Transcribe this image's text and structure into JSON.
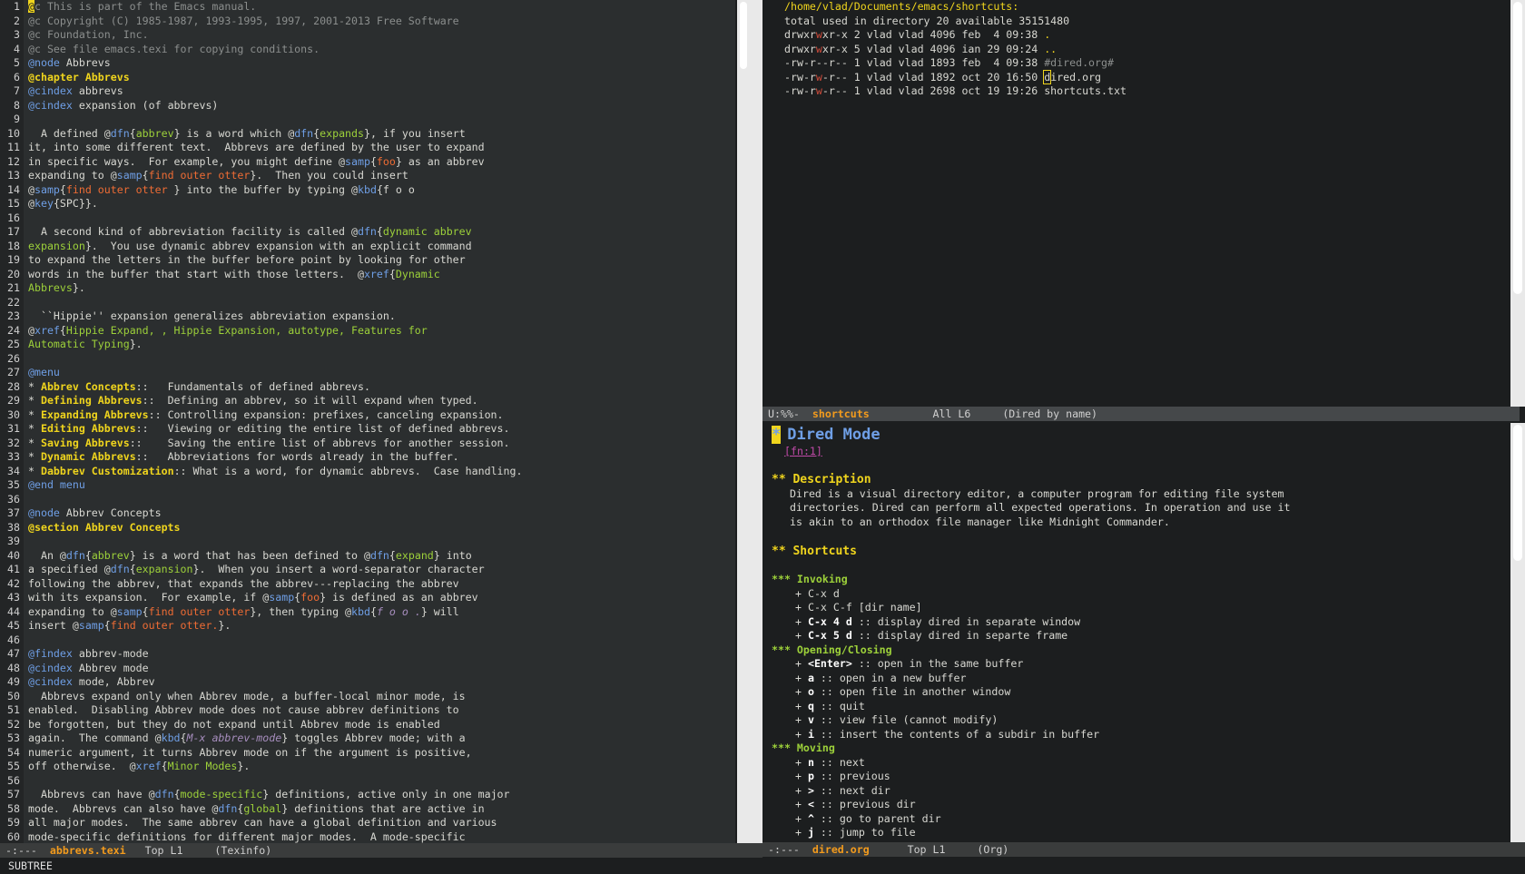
{
  "left": {
    "lines": [
      "<span class=\"cursor\">@</span><span class=\"cm\">c This is part of the Emacs manual.</span>",
      "<span class=\"cm\">@c Copyright (C) 1985-1987, 1993-1995, 1997, 2001-2013 Free Software</span>",
      "<span class=\"cm\">@c Foundation, Inc.</span>",
      "<span class=\"cm\">@c See file emacs.texi for copying conditions.</span>",
      "<span class=\"kn\">@node</span> Abbrevs",
      "<span class=\"h\">@chapter Abbrevs</span>",
      "<span class=\"kn\">@cindex</span> abbrevs",
      "<span class=\"kn\">@cindex</span> expansion (of abbrevs)",
      "",
      "  A defined @<span class=\"kn\">dfn</span>{<span class=\"g\">abbrev</span>} is a word which @<span class=\"kn\">dfn</span>{<span class=\"g\">expands</span>}, if you insert",
      "it, into some different text.  Abbrevs are defined by the user to expand",
      "in specific ways.  For example, you might define @<span class=\"kn\">samp</span>{<span class=\"o\">foo</span>} as an abbrev",
      "expanding to @<span class=\"kn\">samp</span>{<span class=\"o\">find outer otter</span>}.  Then you could insert",
      "@<span class=\"kn\">samp</span>{<span class=\"o\">find outer otter</span> } into the buffer by typing @<span class=\"kn\">kbd</span>{f o o",
      "@<span class=\"kn\">key</span>{SPC}}.",
      "",
      "  A second kind of abbreviation facility is called @<span class=\"kn\">dfn</span>{<span class=\"g\">dynamic abbrev</span>",
      "<span class=\"g\">expansion</span>}.  You use dynamic abbrev expansion with an explicit command",
      "to expand the letters in the buffer before point by looking for other",
      "words in the buffer that start with those letters.  @<span class=\"kn\">xref</span>{<span class=\"g\">Dynamic</span>",
      "<span class=\"g\">Abbrevs</span>}.",
      "",
      "  ``Hippie'' expansion generalizes abbreviation expansion.",
      "@<span class=\"kn\">xref</span>{<span class=\"g\">Hippie Expand, , Hippie Expansion, autotype, Features for</span>",
      "<span class=\"g\">Automatic Typing</span>}.",
      "",
      "<span class=\"kn\">@menu</span>",
      "* <span class=\"h\">Abbrev Concepts</span>::   Fundamentals of defined abbrevs.",
      "* <span class=\"h\">Defining Abbrevs</span>::  Defining an abbrev, so it will expand when typed.",
      "* <span class=\"h\">Expanding Abbrevs</span>:: Controlling expansion: prefixes, canceling expansion.",
      "* <span class=\"h\">Editing Abbrevs</span>::   Viewing or editing the entire list of defined abbrevs.",
      "* <span class=\"h\">Saving Abbrevs</span>::    Saving the entire list of abbrevs for another session.",
      "* <span class=\"h\">Dynamic Abbrevs</span>::   Abbreviations for words already in the buffer.",
      "* <span class=\"h\">Dabbrev Customization</span>:: What is a word, for dynamic abbrevs.  Case handling.",
      "<span class=\"kn\">@end menu</span>",
      "",
      "<span class=\"kn\">@node</span> Abbrev Concepts",
      "<span class=\"h\">@section Abbrev Concepts</span>",
      "",
      "  An @<span class=\"kn\">dfn</span>{<span class=\"g\">abbrev</span>} is a word that has been defined to @<span class=\"kn\">dfn</span>{<span class=\"g\">expand</span>} into",
      "a specified @<span class=\"kn\">dfn</span>{<span class=\"g\">expansion</span>}.  When you insert a word-separator character",
      "following the abbrev, that expands the abbrev---replacing the abbrev",
      "with its expansion.  For example, if @<span class=\"kn\">samp</span>{<span class=\"o\">foo</span>} is defined as an abbrev",
      "expanding to @<span class=\"kn\">samp</span>{<span class=\"o\">find outer otter</span>}, then typing @<span class=\"kn\">kbd</span>{<span class=\"it\">f o o .</span>} will",
      "insert @<span class=\"kn\">samp</span>{<span class=\"o\">find outer otter.</span>}.",
      "",
      "<span class=\"kn\">@findex</span> abbrev-mode",
      "<span class=\"kn\">@cindex</span> Abbrev mode",
      "<span class=\"kn\">@cindex</span> mode, Abbrev",
      "  Abbrevs expand only when Abbrev mode, a buffer-local minor mode, is",
      "enabled.  Disabling Abbrev mode does not cause abbrev definitions to",
      "be forgotten, but they do not expand until Abbrev mode is enabled",
      "again.  The command @<span class=\"kn\">kbd</span>{<span class=\"it\">M-x abbrev-mode</span>} toggles Abbrev mode; with a",
      "numeric argument, it turns Abbrev mode on if the argument is positive,",
      "off otherwise.  @<span class=\"kn\">xref</span>{<span class=\"g\">Minor Modes</span>}.",
      "",
      "  Abbrevs can have @<span class=\"kn\">dfn</span>{<span class=\"g\">mode-specific</span>} definitions, active only in one major",
      "mode.  Abbrevs can also have @<span class=\"kn\">dfn</span>{<span class=\"g\">global</span>} definitions that are active in",
      "all major modes.  The same abbrev can have a global definition and various",
      "mode-specific definitions for different major modes.  A mode-specific"
    ],
    "modeline": {
      "status": "-:---",
      "buffer": "abbrevs.texi",
      "position": "Top L1",
      "mode": "(Texinfo)"
    }
  },
  "dired": {
    "path": "/home/vlad/Documents/emacs/shortcuts",
    "total": "total used in directory 20 available 35151480",
    "entries": [
      {
        "perm": "drwxrwxr-x",
        "links": "2",
        "user": "vlad",
        "group": "vlad",
        "size": "4096",
        "date": "feb  4 09:38",
        "name": "."
      },
      {
        "perm": "drwxrwxr-x",
        "links": "5",
        "user": "vlad",
        "group": "vlad",
        "size": "4096",
        "date": "ian 29 09:24",
        "name": ".."
      },
      {
        "perm": "-rw-r--r--",
        "links": "1",
        "user": "vlad",
        "group": "vlad",
        "size": "1893",
        "date": "feb  4 09:38",
        "name": "#dired.org#"
      },
      {
        "perm": "-rw-rw-r--",
        "links": "1",
        "user": "vlad",
        "group": "vlad",
        "size": "1892",
        "date": "oct 20 16:50",
        "name": "dired.org"
      },
      {
        "perm": "-rw-rw-r--",
        "links": "1",
        "user": "vlad",
        "group": "vlad",
        "size": "2698",
        "date": "oct 19 19:26",
        "name": "shortcuts.txt"
      }
    ],
    "modeline": {
      "status": "U:%%-",
      "buffer": "shortcuts",
      "position": "All L6",
      "mode": "(Dired by name)"
    }
  },
  "org": {
    "title_star": "*",
    "title": "Dired Mode",
    "footnote": "[fn:1]",
    "h_description": "** Description",
    "description": [
      "Dired is a visual directory editor, a computer program for editing file system",
      "directories. Dired can perform all expected operations. In operation and use it",
      "is akin to an orthodox file manager like Midnight Commander."
    ],
    "h_shortcuts": "** Shortcuts",
    "groups": [
      {
        "heading": "*** Invoking",
        "items": [
          {
            "key": "C-x d",
            "desc": "",
            "bold": false
          },
          {
            "key": "C-x C-f [dir name]",
            "desc": "",
            "bold": false
          },
          {
            "key": "C-x 4 d",
            "desc": ":: display dired in separate window",
            "bold": true
          },
          {
            "key": "C-x 5 d",
            "desc": ":: display dired in separte frame",
            "bold": true
          }
        ]
      },
      {
        "heading": "*** Opening/Closing",
        "items": [
          {
            "key": "<Enter>",
            "desc": ":: open in the same buffer",
            "bold": true
          },
          {
            "key": "a",
            "desc": ":: open in a new buffer",
            "bold": true
          },
          {
            "key": "o",
            "desc": ":: open file in another window",
            "bold": true
          },
          {
            "key": "q",
            "desc": ":: quit",
            "bold": true
          },
          {
            "key": "v",
            "desc": ":: view file (cannot modify)",
            "bold": true
          },
          {
            "key": "i",
            "desc": ":: insert the contents of a subdir in buffer",
            "bold": true
          }
        ]
      },
      {
        "heading": "*** Moving",
        "items": [
          {
            "key": "n",
            "desc": ":: next",
            "bold": true
          },
          {
            "key": "p",
            "desc": ":: previous",
            "bold": true
          },
          {
            "key": ">",
            "desc": ":: next dir",
            "bold": true
          },
          {
            "key": "<",
            "desc": ":: previous dir",
            "bold": true
          },
          {
            "key": "^",
            "desc": ":: go to parent dir",
            "bold": true
          },
          {
            "key": "j",
            "desc": ":: jump to file",
            "bold": true
          }
        ]
      }
    ],
    "modeline": {
      "status": "-:---",
      "buffer": "dired.org",
      "position": "Top L1",
      "mode": "(Org)"
    }
  },
  "minibuffer": "SUBTREE"
}
